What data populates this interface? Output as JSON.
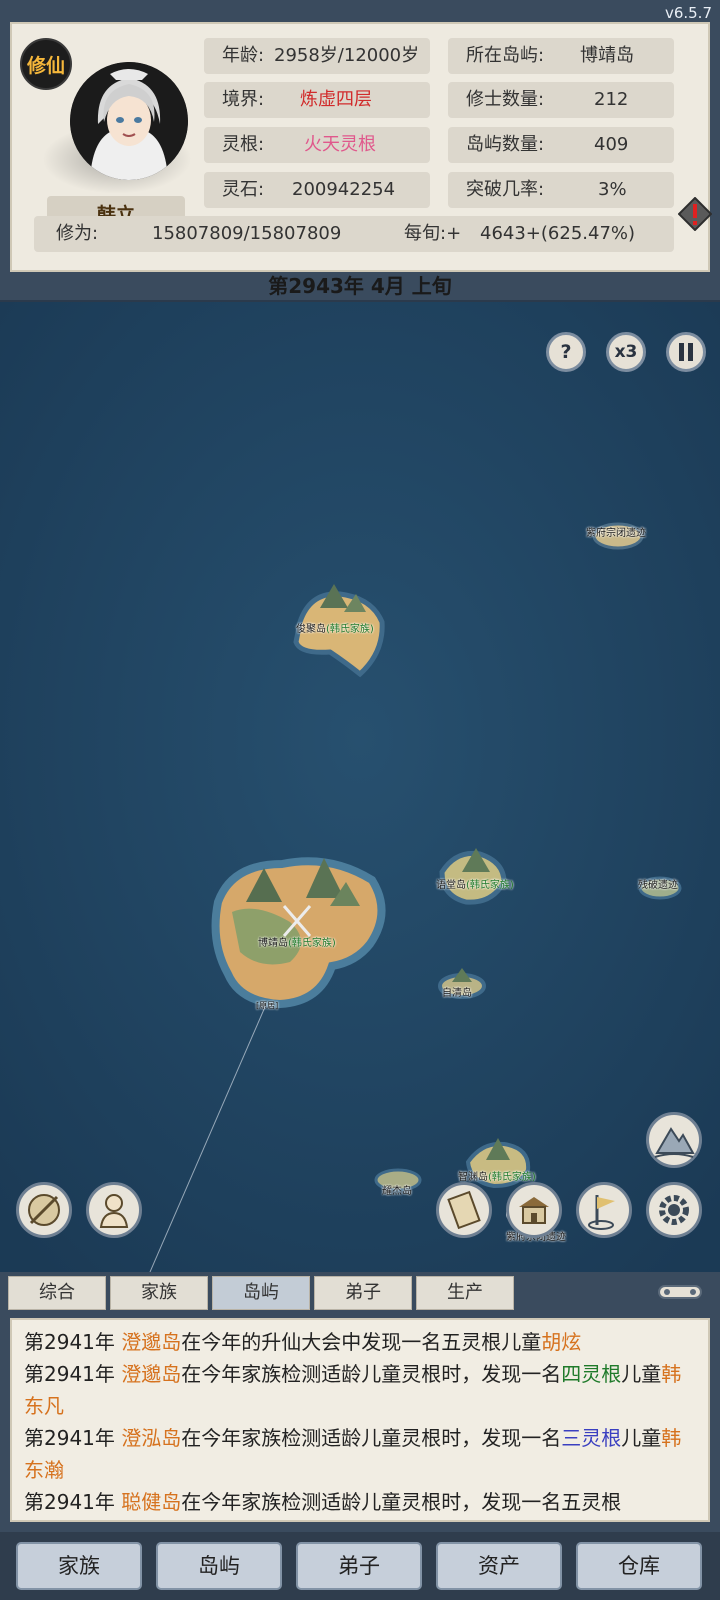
{
  "version": "v6.5.7",
  "badge": "修仙",
  "player": {
    "name": "韩立",
    "age_label": "年龄:",
    "age_value": "2958岁/12000岁",
    "realm_label": "境界:",
    "realm_value": "炼虚四层",
    "root_label": "灵根:",
    "root_value": "火天灵根",
    "stone_label": "灵石:",
    "stone_value": "200942254",
    "island_label": "所在岛屿:",
    "island_value": "博靖岛",
    "cultivators_label": "修士数量:",
    "cultivators_value": "212",
    "islands_label": "岛屿数量:",
    "islands_value": "409",
    "breakthrough_label": "突破几率:",
    "breakthrough_value": "3%",
    "cultivation_label": "修为:",
    "cultivation_value": "15807809/15807809",
    "per_period_label": "每旬:+",
    "per_period_value": "4643+(625.47%)"
  },
  "date": "第2943年 4月 上旬",
  "map": {
    "speed_label": "x3",
    "help_label": "?",
    "islands": [
      {
        "name": "紫府宗闭遗迹",
        "clan": ""
      },
      {
        "name": "俊聚岛",
        "clan": "(韩氏家族)"
      },
      {
        "name": "语堂岛",
        "clan": "(韩氏家族)"
      },
      {
        "name": "残破遗迹",
        "clan": ""
      },
      {
        "name": "博靖岛",
        "clan": "(韩氏家族)"
      },
      {
        "name": "自清岛",
        "clan": ""
      },
      {
        "name": "智渊岛",
        "clan": "(韩氏家族)"
      },
      {
        "name": "紫府宗闭遗迹",
        "clan": ""
      },
      {
        "name": "耀杰岛",
        "clan": ""
      }
    ],
    "marker": "[原居]"
  },
  "tabs": [
    "综合",
    "家族",
    "岛屿",
    "弟子",
    "生产"
  ],
  "active_tab": "岛屿",
  "log": [
    {
      "year": "第2941年",
      "island": "澄邈岛",
      "text": "在今年的升仙大会中发现一名五灵根儿童",
      "kid": "胡炫"
    },
    {
      "year": "第2941年",
      "island": "澄邈岛",
      "text1": "在今年家族检测适龄儿童灵根时，发现一名",
      "grade": "四灵根",
      "text2": "儿童",
      "kid": "韩东凡"
    },
    {
      "year": "第2941年",
      "island": "澄泓岛",
      "text1": "在今年家族检测适龄儿童灵根时，发现一名",
      "grade": "三灵根",
      "text2": "儿童",
      "kid": "韩东瀚"
    },
    {
      "year": "第2941年",
      "island": "聪健岛",
      "text": "在今年家族检测适龄儿童灵根时，发现一名五灵根"
    }
  ],
  "nav": [
    "家族",
    "岛屿",
    "弟子",
    "资产",
    "仓库"
  ],
  "colors": {
    "realm": "#d12b2b",
    "root": "#e0588c",
    "island_name": "#d6721e",
    "clan": "#1f7a2a"
  }
}
